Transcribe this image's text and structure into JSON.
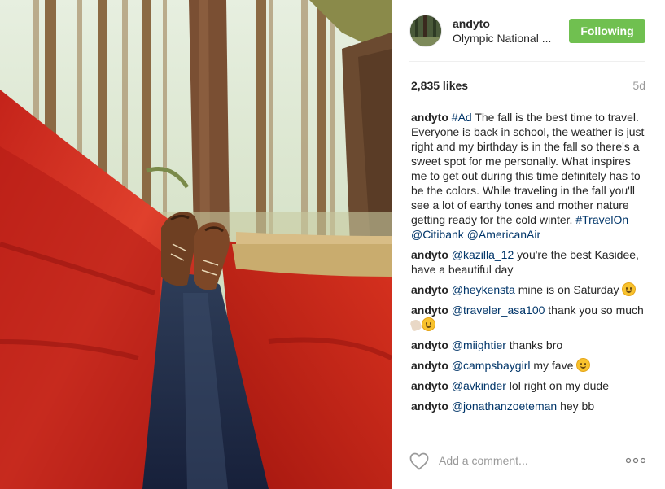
{
  "header": {
    "username": "andyto",
    "location": "Olympic National ...",
    "follow_label": "Following",
    "follow_color": "#70c050",
    "avatar_icon": "avatar"
  },
  "stats": {
    "likes": "2,835 likes",
    "time": "5d"
  },
  "caption": {
    "user": "andyto",
    "tag": "#Ad",
    "text": " The fall is the best time to travel. Everyone is back in school, the weather is just right and  my birthday is in the fall so there's a sweet spot for me personally. What inspires me to get out during this time definitely has to be the colors. While traveling in the fall you'll see a lot of earthy tones and mother nature getting ready for the cold winter.  ",
    "links": [
      "#TravelOn",
      "@Citibank",
      "@AmericanAir"
    ]
  },
  "comments": [
    {
      "user": "andyto",
      "mention": "@kazilla_12",
      "text": " you're the best Kasidee, have a beautiful day"
    },
    {
      "user": "andyto",
      "mention": "@heykensta",
      "text": " mine is on Saturday "
    },
    {
      "user": "andyto",
      "mention": "@traveler_asa100",
      "text": " thank you so much "
    },
    {
      "user": "andyto",
      "mention": "@miightier",
      "text": " thanks bro"
    },
    {
      "user": "andyto",
      "mention": "@campsbaygirl",
      "text": " my fave "
    },
    {
      "user": "andyto",
      "mention": "@avkinder",
      "text": " lol right on my dude"
    },
    {
      "user": "andyto",
      "mention": "@jonathanzoeteman",
      "text": " hey bb"
    }
  ],
  "footer": {
    "placeholder": "Add a comment...",
    "like_icon": "heart-icon",
    "more_icon": "more-options-icon"
  },
  "colors": {
    "link": "#003569",
    "muted": "#999999",
    "text": "#262626"
  }
}
